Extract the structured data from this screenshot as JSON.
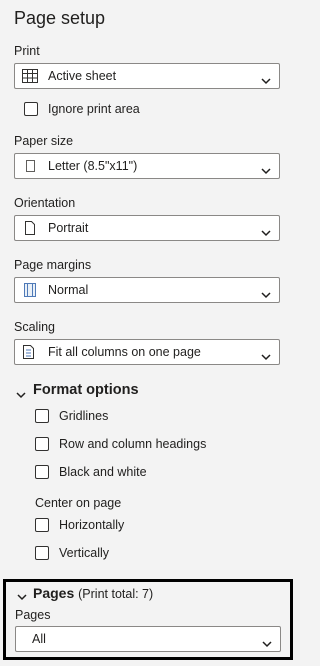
{
  "title": "Page setup",
  "print": {
    "label": "Print",
    "value": "Active sheet",
    "icon": "table-grid-icon",
    "ignore_print_area": {
      "label": "Ignore print area",
      "checked": false
    }
  },
  "paper_size": {
    "label": "Paper size",
    "value": "Letter (8.5\"x11\")",
    "icon": "page-icon"
  },
  "orientation": {
    "label": "Orientation",
    "value": "Portrait",
    "icon": "portrait-page-icon"
  },
  "page_margins": {
    "label": "Page margins",
    "value": "Normal",
    "icon": "margins-icon"
  },
  "scaling": {
    "label": "Scaling",
    "value": "Fit all columns on one page",
    "icon": "fit-columns-icon"
  },
  "format_options": {
    "title": "Format options",
    "expanded": true,
    "items": [
      {
        "label": "Gridlines",
        "checked": false
      },
      {
        "label": "Row and column headings",
        "checked": false
      },
      {
        "label": "Black and white",
        "checked": false
      }
    ],
    "center_on_page": {
      "label": "Center on page",
      "items": [
        {
          "label": "Horizontally",
          "checked": false
        },
        {
          "label": "Vertically",
          "checked": false
        }
      ]
    }
  },
  "pages": {
    "title": "Pages",
    "print_total": "(Print total: 7)",
    "expanded": true,
    "field_label": "Pages",
    "value": "All"
  },
  "colors": {
    "panel_bg": "#f3f3f3",
    "field_border": "#8a8886",
    "highlight_border": "#000000"
  }
}
